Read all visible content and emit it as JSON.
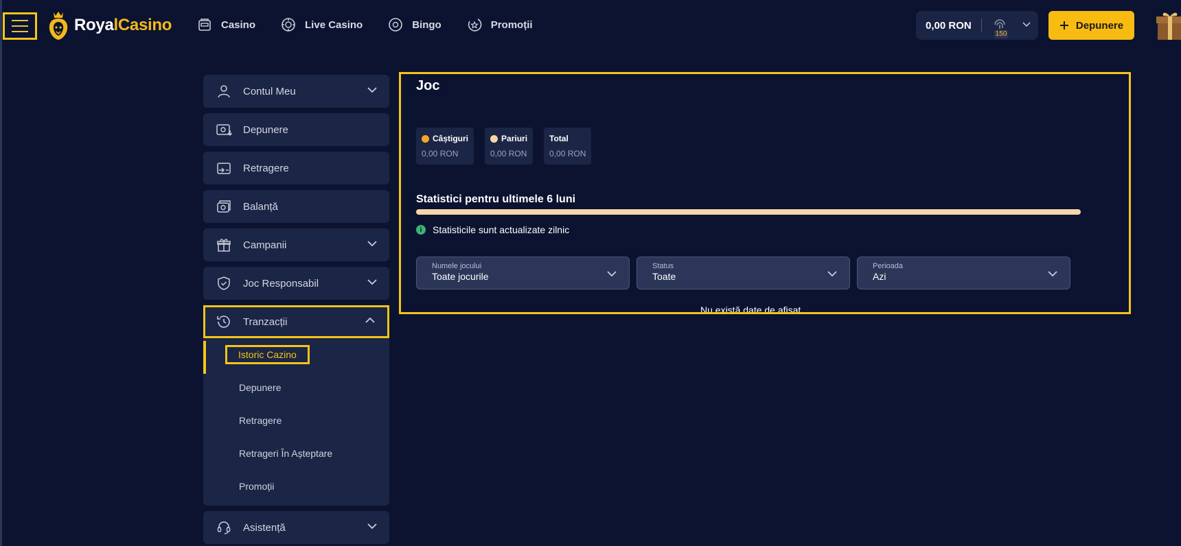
{
  "header": {
    "logo_part1": "Roya",
    "logo_part2": "l",
    "logo_part3": "Casino",
    "nav": [
      {
        "label": "Casino",
        "icon": "slot-machine-icon"
      },
      {
        "label": "Live Casino",
        "icon": "poker-chip-icon"
      },
      {
        "label": "Bingo",
        "icon": "bingo-ball-icon"
      },
      {
        "label": "Promoții",
        "icon": "promo-star-icon"
      }
    ],
    "balance": "0,00 RON",
    "points": "150",
    "deposit_label": "Depunere"
  },
  "sidebar": {
    "items": [
      {
        "label": "Contul Meu",
        "icon": "user-icon"
      },
      {
        "label": "Depunere",
        "icon": "deposit-icon"
      },
      {
        "label": "Retragere",
        "icon": "withdraw-icon"
      },
      {
        "label": "Balanță",
        "icon": "balance-icon"
      },
      {
        "label": "Campanii",
        "icon": "gift-icon"
      },
      {
        "label": "Joc Responsabil",
        "icon": "shield-icon"
      },
      {
        "label": "Tranzacții",
        "icon": "history-icon"
      },
      {
        "label": "Asistență",
        "icon": "headset-icon"
      }
    ],
    "submenu": [
      "Istoric Cazino",
      "Depunere",
      "Retragere",
      "Retrageri În Așteptare",
      "Promoții"
    ]
  },
  "main": {
    "title": "Joc",
    "stats": [
      {
        "label": "Câștiguri",
        "value": "0,00 RON",
        "color": "#f6a623"
      },
      {
        "label": "Pariuri",
        "value": "0,00 RON",
        "color": "#f7d4a4"
      },
      {
        "label": "Total",
        "value": "0,00 RON"
      }
    ],
    "section_title": "Statistici pentru ultimele 6 luni",
    "info_text": "Statisticile sunt actualizate zilnic",
    "filters": [
      {
        "label": "Numele jocului",
        "value": "Toate jocurile"
      },
      {
        "label": "Status",
        "value": "Toate"
      },
      {
        "label": "Perioada",
        "value": "Azi"
      }
    ],
    "empty_text": "Nu există date de afișat"
  }
}
